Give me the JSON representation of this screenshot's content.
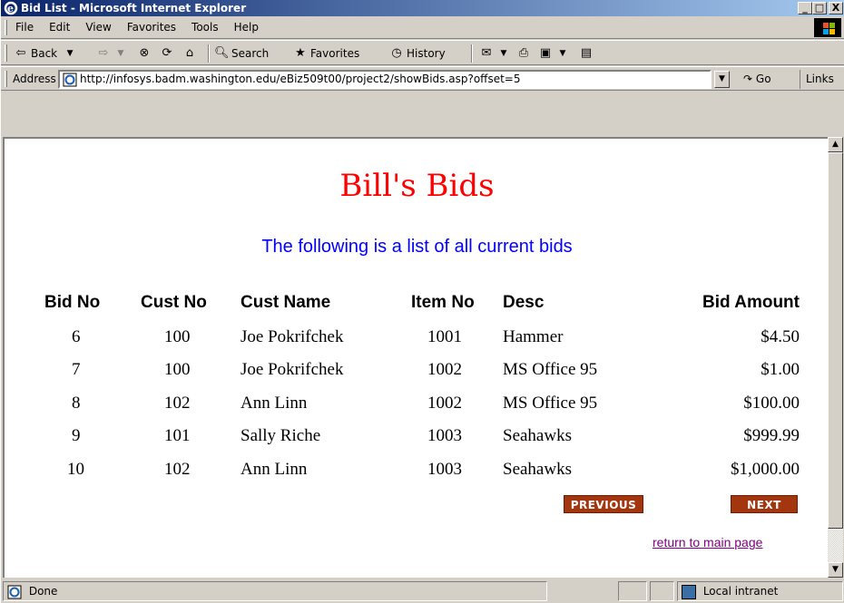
{
  "window": {
    "title": "Bid List - Microsoft Internet Explorer",
    "minimize": "_",
    "maximize": "□",
    "close": "X"
  },
  "menu": {
    "items": [
      "File",
      "Edit",
      "View",
      "Favorites",
      "Tools",
      "Help"
    ]
  },
  "toolbar": {
    "back": "Back",
    "search": "Search",
    "favorites": "Favorites",
    "history": "History"
  },
  "address": {
    "label": "Address",
    "url": "http://infosys.badm.washington.edu/eBiz509t00/project2/showBids.asp?offset=5",
    "go": "Go",
    "links": "Links"
  },
  "page": {
    "title": "Bill's Bids",
    "subtitle": "The following is a list of all current bids",
    "columns": [
      "Bid No",
      "Cust No",
      "Cust Name",
      "Item No",
      "Desc",
      "Bid Amount"
    ],
    "rows": [
      [
        "6",
        "100",
        "Joe Pokrifchek",
        "1001",
        "Hammer",
        "$4.50"
      ],
      [
        "7",
        "100",
        "Joe Pokrifchek",
        "1002",
        "MS Office 95",
        "$1.00"
      ],
      [
        "8",
        "102",
        "Ann Linn",
        "1002",
        "MS Office 95",
        "$100.00"
      ],
      [
        "9",
        "101",
        "Sally Riche",
        "1003",
        "Seahawks",
        "$999.99"
      ],
      [
        "10",
        "102",
        "Ann Linn",
        "1003",
        "Seahawks",
        "$1,000.00"
      ]
    ],
    "previous_label": "PREVIOUS",
    "next_label": "NEXT",
    "return_link": "return to main page"
  },
  "status": {
    "text": "Done",
    "zone": "Local intranet"
  },
  "colors": {
    "title_red": "#ff0000",
    "subtitle_blue": "#0000ff",
    "button_brown": "#a3360e",
    "visited_link": "#800080"
  }
}
